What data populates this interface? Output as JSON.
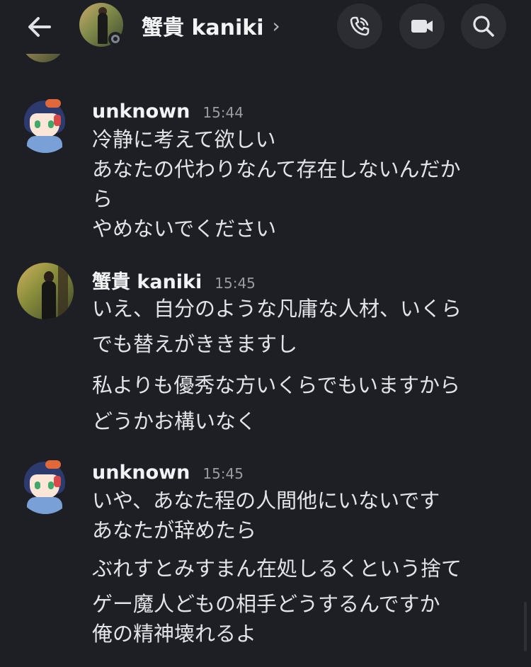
{
  "header": {
    "title": "蟹貴 kaniki",
    "title_chevron": "›",
    "back_icon": "arrow-left-icon",
    "call_icon": "phone-call-icon",
    "video_icon": "video-camera-icon",
    "search_icon": "search-icon"
  },
  "messages": [
    {
      "author": "unknown",
      "time": "15:44",
      "lines": [
        "冷静に考えて欲しい",
        "あなたの代わりなんて存在しないんだか",
        "ら",
        "やめないでください"
      ]
    },
    {
      "author": "蟹貴 kaniki",
      "time": "15:45",
      "lines": [
        "いえ、自分のような凡庸な人材、いくら",
        "でも替えがききますし",
        "私よりも優秀な方いくらでもいますから",
        "どうかお構いなく"
      ]
    },
    {
      "author": "unknown",
      "time": "15:45",
      "lines": [
        "いや、あなた程の人間他にいないです",
        "あなたが辞めたら",
        "ぶれすとみすまん在処しるくという捨て",
        "ゲー魔人どもの相手どうするんですか",
        "俺の精神壊れるよ"
      ]
    }
  ],
  "colors": {
    "background": "#1e1f24",
    "text": "#e3e4e8",
    "muted": "#9a9ca3",
    "button_bg": "#2b2d33"
  }
}
